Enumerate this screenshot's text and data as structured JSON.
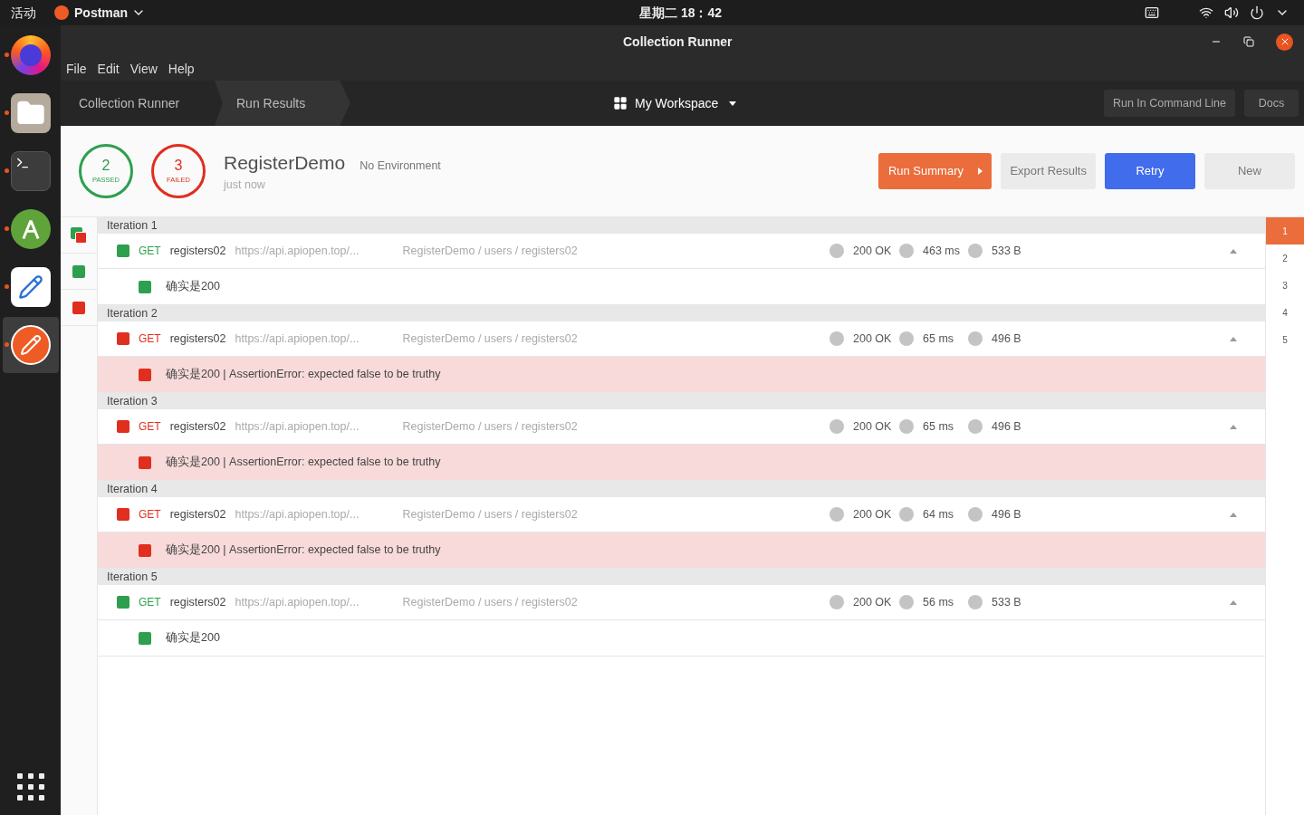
{
  "top_bar": {
    "activities": "活动",
    "app": "Postman",
    "clock": "星期二 18：42"
  },
  "dock": [
    {
      "kind": "firefox",
      "running": true,
      "selected": false
    },
    {
      "kind": "files",
      "running": true,
      "selected": false
    },
    {
      "kind": "terminal",
      "running": true,
      "selected": false
    },
    {
      "kind": "android",
      "running": true,
      "selected": false
    },
    {
      "kind": "editor",
      "running": true,
      "selected": false
    },
    {
      "kind": "postman",
      "running": true,
      "selected": true
    }
  ],
  "window": {
    "title": "Collection Runner"
  },
  "menu": [
    "File",
    "Edit",
    "View",
    "Help"
  ],
  "breadcrumbs": [
    {
      "label": "Collection Runner",
      "selected": false
    },
    {
      "label": "Run Results",
      "selected": true
    }
  ],
  "workspace": "My Workspace",
  "toolbar_buttons": [
    "Run In Command Line",
    "Docs"
  ],
  "summary": {
    "passed": {
      "count": "2",
      "label": "PASSED"
    },
    "failed": {
      "count": "3",
      "label": "FAILED"
    },
    "collection": "RegisterDemo",
    "environment": "No Environment",
    "time": "just now"
  },
  "actions": [
    {
      "kind": "summary",
      "label": "Run Summary"
    },
    {
      "kind": "plain",
      "label": "Export Results"
    },
    {
      "kind": "primary",
      "label": "Retry"
    },
    {
      "kind": "plain",
      "label": "New"
    }
  ],
  "filters": [
    {
      "kind": "all"
    },
    {
      "kind": "passed"
    },
    {
      "kind": "failed"
    }
  ],
  "iterations": [
    {
      "label": "Iteration 1",
      "request": {
        "passed": true,
        "method": "GET",
        "name": "registers02",
        "url": "https://api.apiopen.top/...",
        "path": "RegisterDemo / users / registers02",
        "code": "200 OK",
        "time": "463 ms",
        "size": "533 B",
        "expanded": true
      },
      "tests": [
        {
          "passed": true,
          "text": "确实是200"
        }
      ]
    },
    {
      "label": "Iteration 2",
      "request": {
        "passed": false,
        "method": "GET",
        "name": "registers02",
        "url": "https://api.apiopen.top/...",
        "path": "RegisterDemo / users / registers02",
        "code": "200 OK",
        "time": "65 ms",
        "size": "496 B",
        "expanded": true
      },
      "tests": [
        {
          "passed": false,
          "text": "确实是200 | AssertionError: expected false to be truthy"
        }
      ]
    },
    {
      "label": "Iteration 3",
      "request": {
        "passed": false,
        "method": "GET",
        "name": "registers02",
        "url": "https://api.apiopen.top/...",
        "path": "RegisterDemo / users / registers02",
        "code": "200 OK",
        "time": "65 ms",
        "size": "496 B",
        "expanded": true
      },
      "tests": [
        {
          "passed": false,
          "text": "确实是200 | AssertionError: expected false to be truthy"
        }
      ]
    },
    {
      "label": "Iteration 4",
      "request": {
        "passed": false,
        "method": "GET",
        "name": "registers02",
        "url": "https://api.apiopen.top/...",
        "path": "RegisterDemo / users / registers02",
        "code": "200 OK",
        "time": "64 ms",
        "size": "496 B",
        "expanded": true
      },
      "tests": [
        {
          "passed": false,
          "text": "确实是200 | AssertionError: expected false to be truthy"
        }
      ]
    },
    {
      "label": "Iteration 5",
      "request": {
        "passed": true,
        "method": "GET",
        "name": "registers02",
        "url": "https://api.apiopen.top/...",
        "path": "RegisterDemo / users / registers02",
        "code": "200 OK",
        "time": "56 ms",
        "size": "533 B",
        "expanded": true
      },
      "tests": [
        {
          "passed": true,
          "text": "确实是200"
        }
      ]
    }
  ],
  "pager": [
    {
      "label": "1",
      "selected": true
    },
    {
      "label": "2",
      "selected": false
    },
    {
      "label": "3",
      "selected": false
    },
    {
      "label": "4",
      "selected": false
    },
    {
      "label": "5",
      "selected": false
    }
  ]
}
